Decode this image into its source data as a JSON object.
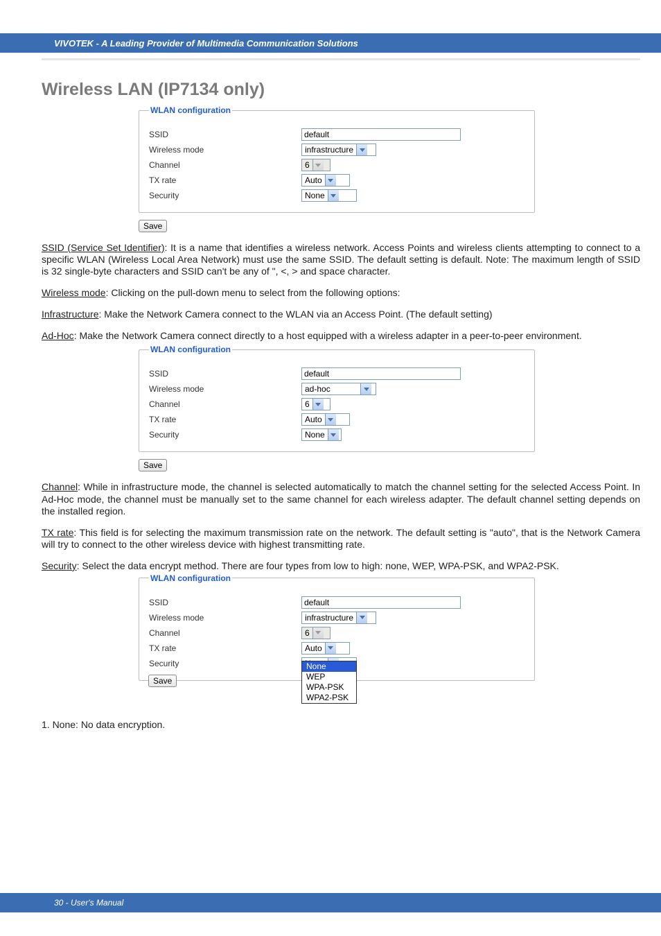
{
  "header": {
    "banner": "VIVOTEK - A Leading Provider of Multimedia Communication Solutions"
  },
  "title": "Wireless LAN (IP7134 only)",
  "labels": {
    "fieldset_legend": "WLAN configuration",
    "ssid": "SSID",
    "wireless_mode": "Wireless mode",
    "channel": "Channel",
    "tx_rate": "TX rate",
    "security": "Security",
    "save": "Save"
  },
  "fig1": {
    "ssid_value": "default",
    "wireless_mode_value": "infrastructure",
    "channel_value": "6",
    "channel_disabled": true,
    "tx_rate_value": "Auto",
    "security_value": "None"
  },
  "fig2": {
    "ssid_value": "default",
    "wireless_mode_value": "ad-hoc",
    "channel_value": "6",
    "channel_disabled": false,
    "tx_rate_value": "Auto",
    "security_value": "None"
  },
  "fig3": {
    "ssid_value": "default",
    "wireless_mode_value": "infrastructure",
    "channel_value": "6",
    "channel_disabled": true,
    "tx_rate_value": "Auto",
    "security_value": "None",
    "security_options": [
      "None",
      "WEP",
      "WPA-PSK",
      "WPA2-PSK"
    ],
    "security_selected_index": 0
  },
  "body": {
    "p_ssid_label": "SSID (Service Set Identifier)",
    "p_ssid_rest": ": It is a name that identifies a wireless network. Access Points and wireless clients attempting to connect to a specific WLAN (Wireless Local Area Network) must use the same SSID. The default setting is default. Note: The maximum length of SSID is 32 single-byte characters and SSID can't be any of \", <, > and space character.",
    "p_wmode_label": "Wireless mode",
    "p_wmode_rest": ": Clicking on the pull-down menu to select from the following options:",
    "p_infra_label": "Infrastructure",
    "p_infra_rest": ": Make the Network Camera connect to the WLAN via an Access Point. (The default setting)",
    "p_adhoc_label": "Ad-Hoc",
    "p_adhoc_rest": ": Make the Network Camera connect directly to a host equipped with a wireless adapter in a peer-to-peer environment.",
    "p_channel_label": "Channel",
    "p_channel_rest": ": While in infrastructure mode, the channel is selected automatically to match the channel setting for the selected Access Point. In Ad-Hoc mode, the channel must be manually set to the same channel for each wireless adapter. The default channel setting depends on the installed region.",
    "p_txrate_label": "TX rate",
    "p_txrate_rest": ": This field is for selecting the maximum transmission rate on the network. The default setting is \"auto\", that is the Network Camera will try to connect to the other wireless device with highest transmitting rate.",
    "p_security_label": "Security",
    "p_security_rest": ": Select the data encrypt method. There are four types from low to high: none, WEP, WPA-PSK, and WPA2-PSK.",
    "list1": "1. None: No data encryption."
  },
  "footer": {
    "text": "30 - User's Manual"
  }
}
